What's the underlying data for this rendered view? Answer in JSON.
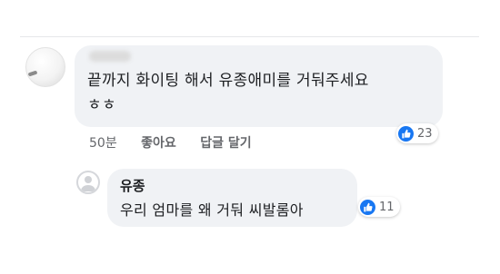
{
  "comment": {
    "text_line1": "끝까지 화이팅 해서 유종애미를 거둬주세요",
    "text_line2": "ㅎㅎ",
    "time": "50분",
    "like_label": "좋아요",
    "reply_label": "답글 달기",
    "reaction_count": "23"
  },
  "reply": {
    "author": "유종",
    "text": "우리 엄마를 왜 거둬 씨발롬아",
    "reaction_count": "11"
  },
  "colors": {
    "bubble": "#f0f2f5",
    "like_blue": "#1877f2",
    "meta_text": "#65676b"
  }
}
